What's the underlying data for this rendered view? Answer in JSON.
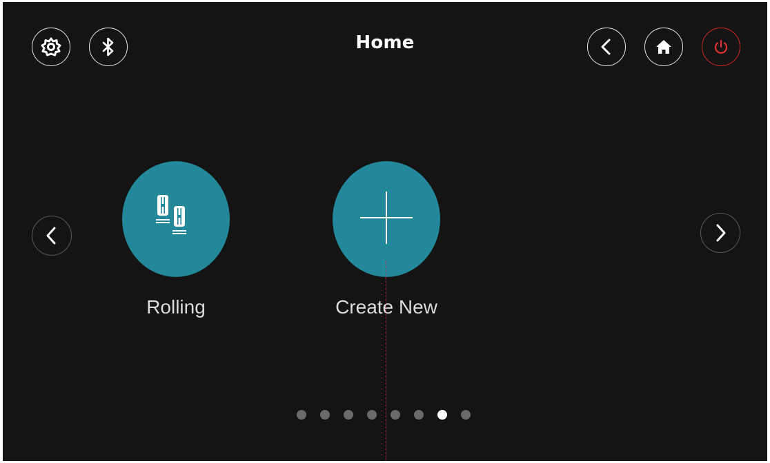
{
  "header": {
    "title": "Home",
    "left_icons": [
      "settings-icon",
      "bluetooth-icon"
    ],
    "right_icons": [
      "back-icon",
      "home-icon",
      "power-icon"
    ]
  },
  "colors": {
    "background": "#141414",
    "tile": "#23899a",
    "power": "#d42626",
    "dot_active": "#ffffff",
    "dot_inactive": "#6a6a6a"
  },
  "tiles": [
    {
      "label": "Rolling",
      "icon": "rollers-icon"
    },
    {
      "label": "Create New",
      "icon": "plus-icon"
    }
  ],
  "pager": {
    "total": 8,
    "active_index": 6
  }
}
